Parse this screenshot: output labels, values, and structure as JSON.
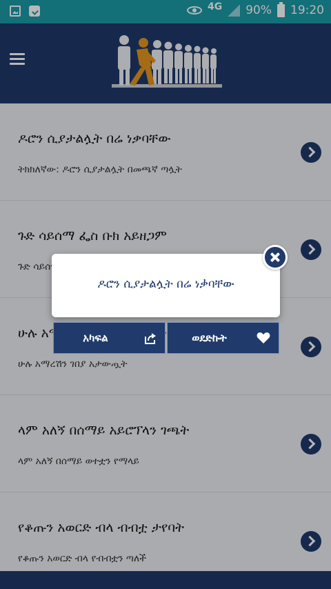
{
  "status_bar": {
    "network": "4G",
    "battery": "90%",
    "time": "19:20"
  },
  "list": [
    {
      "title": "ዶሮን ሲያታልሏት በሬ ነቃባቸው",
      "subtitle": "ትክክለኛው: ዶሮን ሲያታልሏት በመጫኛ ጣሏት"
    },
    {
      "title": "ጉድ ሳይሰማ ፌስ ቡክ አይዘጋም",
      "subtitle": "ጉድ ሳይሰማ መስከረም አይጠባም"
    },
    {
      "title": "ሁሉ አማረሽን ገበያ አታውጧት",
      "subtitle": "ሁሉ አማረሽን ገበያ አታውጧት"
    },
    {
      "title": "ላም አለኝ በሰማይ አይሮፕላን ገጫት",
      "subtitle": "ላም አለኝ በሰማይ ወተቷን የማላይ"
    },
    {
      "title": "የቆጡን አወርድ ብላ ብብቷ ታየባት",
      "subtitle": "የቆጡን አወርድ ብላ የብብቷን ጣለች"
    }
  ],
  "dialog": {
    "text": "ዶሮን ሲያታልሏት በሬ ነቃባቸው",
    "share_label": "አካፍል",
    "favorite_label": "ወደድኩት"
  },
  "colors": {
    "status_bar": "#1b9aa7",
    "primary": "#1f3a6b",
    "accent": "#e3961f"
  }
}
